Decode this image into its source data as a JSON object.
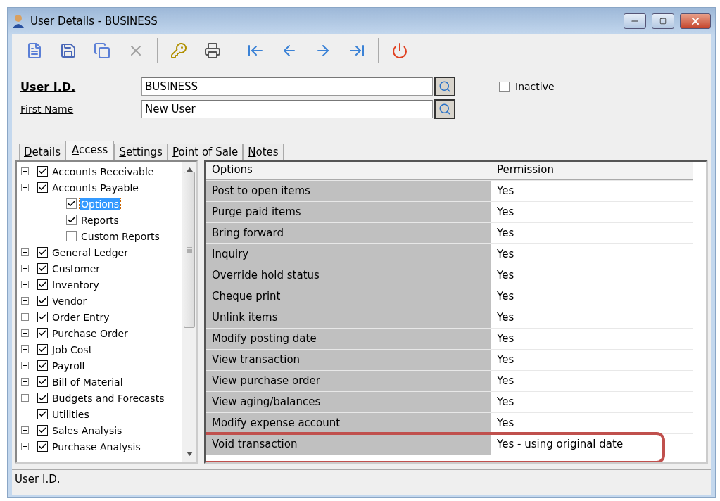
{
  "window": {
    "title": "User Details - BUSINESS"
  },
  "toolbar": [
    {
      "kind": "new",
      "disabled": false
    },
    {
      "kind": "save",
      "disabled": false
    },
    {
      "kind": "copy",
      "disabled": false
    },
    {
      "kind": "delete",
      "disabled": true
    },
    {
      "kind": "sep"
    },
    {
      "kind": "key",
      "disabled": false
    },
    {
      "kind": "print",
      "disabled": false
    },
    {
      "kind": "sep"
    },
    {
      "kind": "first",
      "disabled": false
    },
    {
      "kind": "prev",
      "disabled": false
    },
    {
      "kind": "next",
      "disabled": false
    },
    {
      "kind": "last",
      "disabled": false
    },
    {
      "kind": "sep"
    },
    {
      "kind": "close",
      "disabled": false
    }
  ],
  "fields": [
    {
      "label": "User I.D.",
      "value": "BUSINESS",
      "required": true
    },
    {
      "label": "First Name",
      "value": "New User",
      "required": false
    }
  ],
  "inactive": {
    "label": "Inactive",
    "checked": false
  },
  "tabs": [
    {
      "label": "Details",
      "selected": false
    },
    {
      "label": "Access",
      "selected": true
    },
    {
      "label": "Settings",
      "selected": false
    },
    {
      "label": "Point of Sale",
      "selected": false
    },
    {
      "label": "Notes",
      "selected": false
    }
  ],
  "tree": [
    {
      "label": "Accounts Receivable",
      "checked": true,
      "selected": false,
      "kind": "branch",
      "expanded": false
    },
    {
      "label": "Accounts Payable",
      "checked": true,
      "selected": false,
      "kind": "branch",
      "expanded": true,
      "children": [
        {
          "label": "Options",
          "checked": true,
          "selected": true
        },
        {
          "label": "Reports",
          "checked": true,
          "selected": false
        },
        {
          "label": "Custom Reports",
          "checked": false,
          "selected": false
        }
      ]
    },
    {
      "label": "General Ledger",
      "checked": true,
      "selected": false,
      "kind": "branch",
      "expanded": false
    },
    {
      "label": "Customer",
      "checked": true,
      "selected": false,
      "kind": "branch",
      "expanded": false
    },
    {
      "label": "Inventory",
      "checked": true,
      "selected": false,
      "kind": "branch",
      "expanded": false
    },
    {
      "label": "Vendor",
      "checked": true,
      "selected": false,
      "kind": "branch",
      "expanded": false
    },
    {
      "label": "Order Entry",
      "checked": true,
      "selected": false,
      "kind": "branch",
      "expanded": false
    },
    {
      "label": "Purchase Order",
      "checked": true,
      "selected": false,
      "kind": "branch",
      "expanded": false
    },
    {
      "label": "Job Cost",
      "checked": true,
      "selected": false,
      "kind": "branch",
      "expanded": false
    },
    {
      "label": "Payroll",
      "checked": true,
      "selected": false,
      "kind": "branch",
      "expanded": false
    },
    {
      "label": "Bill of Material",
      "checked": true,
      "selected": false,
      "kind": "branch",
      "expanded": false
    },
    {
      "label": "Budgets and Forecasts",
      "checked": true,
      "selected": false,
      "kind": "branch",
      "expanded": false
    },
    {
      "label": "Utilities",
      "checked": true,
      "selected": false,
      "kind": "leaf"
    },
    {
      "label": "Sales Analysis",
      "checked": true,
      "selected": false,
      "kind": "branch",
      "expanded": false
    },
    {
      "label": "Purchase Analysis",
      "checked": true,
      "selected": false,
      "kind": "branch",
      "expanded": false
    }
  ],
  "table": {
    "columns": [
      "Options",
      "Permission"
    ],
    "rows": [
      {
        "option": "Post to open items",
        "permission": "Yes",
        "highlighted": false
      },
      {
        "option": "Purge paid items",
        "permission": "Yes",
        "highlighted": false
      },
      {
        "option": "Bring forward",
        "permission": "Yes",
        "highlighted": false
      },
      {
        "option": "Inquiry",
        "permission": "Yes",
        "highlighted": false
      },
      {
        "option": "Override hold status",
        "permission": "Yes",
        "highlighted": false
      },
      {
        "option": "Cheque print",
        "permission": "Yes",
        "highlighted": false
      },
      {
        "option": "Unlink items",
        "permission": "Yes",
        "highlighted": false
      },
      {
        "option": "Modify posting date",
        "permission": "Yes",
        "highlighted": false
      },
      {
        "option": "View transaction",
        "permission": "Yes",
        "highlighted": false
      },
      {
        "option": "View purchase order",
        "permission": "Yes",
        "highlighted": false
      },
      {
        "option": "View aging/balances",
        "permission": "Yes",
        "highlighted": false
      },
      {
        "option": "Modify expense account",
        "permission": "Yes",
        "highlighted": false
      },
      {
        "option": "Void transaction",
        "permission": "Yes - using original date",
        "highlighted": true
      }
    ]
  },
  "status_bar": "User I.D."
}
